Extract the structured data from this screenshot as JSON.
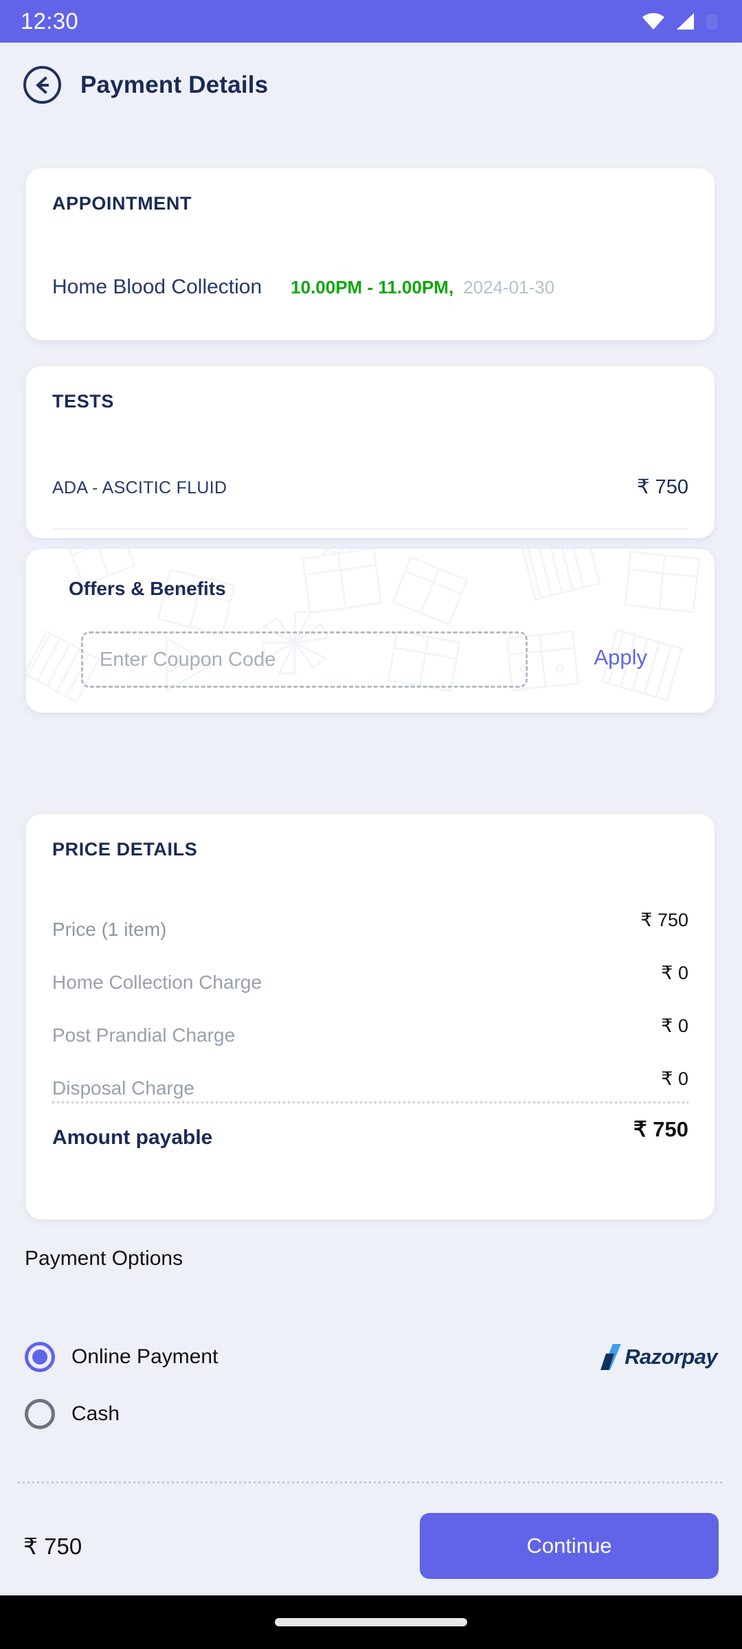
{
  "status_bar": {
    "time": "12:30",
    "wifi_icon": "wifi-icon",
    "signal_icon": "cellular-signal-icon"
  },
  "header": {
    "title": "Payment Details",
    "back_icon": "back-arrow-icon"
  },
  "appointment": {
    "section_title": "APPOINTMENT",
    "service": "Home Blood Collection",
    "time_slot": "10.00PM - 11.00PM,",
    "date": "2024-01-30"
  },
  "tests": {
    "section_title": "TESTS",
    "items": [
      {
        "name": "ADA - ASCITIC FLUID",
        "price": "₹ 750"
      }
    ]
  },
  "offers": {
    "section_title": "Offers & Benefits",
    "coupon_value": "",
    "coupon_placeholder": "Enter Coupon Code",
    "apply_label": "Apply"
  },
  "price_details": {
    "section_title": "PRICE DETAILS",
    "rows": [
      {
        "label": "Price (1 item)",
        "value": "₹ 750"
      },
      {
        "label": "Home Collection Charge",
        "value": "₹ 0"
      },
      {
        "label": "Post Prandial Charge",
        "value": "₹ 0"
      },
      {
        "label": "Disposal Charge",
        "value": "₹ 0"
      }
    ],
    "total_label": "Amount payable",
    "total_value": "₹ 750"
  },
  "payment_options": {
    "title": "Payment Options",
    "options": [
      {
        "label": "Online Payment",
        "selected": true,
        "provider": "Razorpay"
      },
      {
        "label": "Cash",
        "selected": false,
        "provider": ""
      }
    ]
  },
  "bottom_bar": {
    "amount": "₹ 750",
    "continue_label": "Continue"
  },
  "colors": {
    "accent": "#6164E8",
    "navy": "#1B2A56",
    "green": "#0AA80A",
    "muted": "#9A9FAE",
    "background": "#EEF0F8"
  }
}
